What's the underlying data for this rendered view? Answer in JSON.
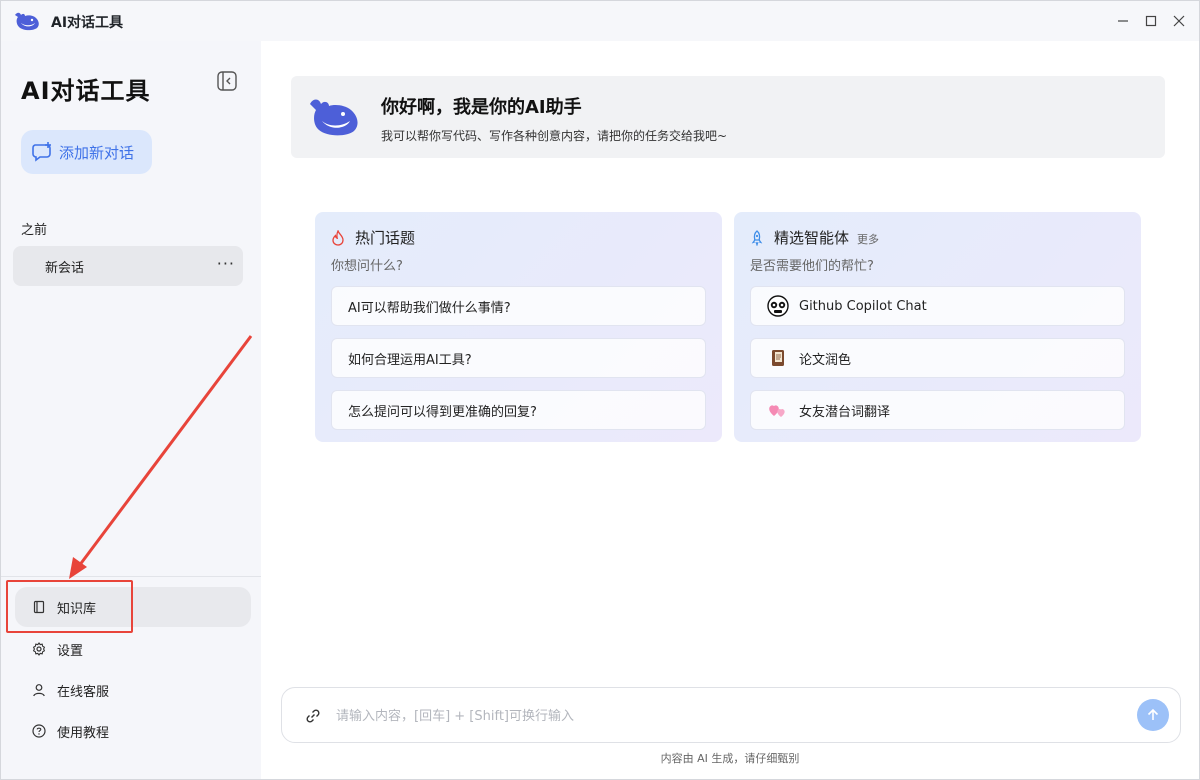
{
  "window": {
    "title": "AI对话工具",
    "controls": {
      "minimize": "minimize",
      "maximize": "maximize",
      "close": "close"
    }
  },
  "sidebar": {
    "brand": "AI对话工具",
    "new_chat_label": "添加新对话",
    "section_label": "之前",
    "conversations": [
      {
        "title": "新会话",
        "more": "···"
      }
    ],
    "nav": [
      {
        "label": "知识库",
        "icon": "book-icon"
      },
      {
        "label": "设置",
        "icon": "gear-icon"
      },
      {
        "label": "在线客服",
        "icon": "user-icon"
      },
      {
        "label": "使用教程",
        "icon": "help-circle-icon"
      }
    ]
  },
  "hero": {
    "title": "你好啊，我是你的AI助手",
    "subtitle": "我可以帮你写代码、写作各种创意内容，请把你的任务交给我吧~"
  },
  "cards": {
    "hot": {
      "title": "热门话题",
      "subtitle": "你想问什么?",
      "items": [
        "AI可以帮助我们做什么事情?",
        "如何合理运用AI工具?",
        "怎么提问可以得到更准确的回复?"
      ]
    },
    "agents": {
      "title": "精选智能体",
      "more": "更多",
      "subtitle": "是否需要他们的帮忙?",
      "items": [
        {
          "label": "Github Copilot Chat",
          "icon": "copilot-icon"
        },
        {
          "label": "论文润色",
          "icon": "notebook-icon"
        },
        {
          "label": "女友潜台词翻译",
          "icon": "hearts-icon"
        }
      ]
    }
  },
  "input": {
    "placeholder": "请输入内容，[回车] + [Shift]可换行输入",
    "value": ""
  },
  "footer": {
    "disclaimer": "内容由 AI 生成，请仔细甄别"
  },
  "colors": {
    "accent": "#3f72e8",
    "new_chat_bg": "#dbe7fc",
    "send_button": "#9cc1f8",
    "annotation": "#e8443a"
  }
}
